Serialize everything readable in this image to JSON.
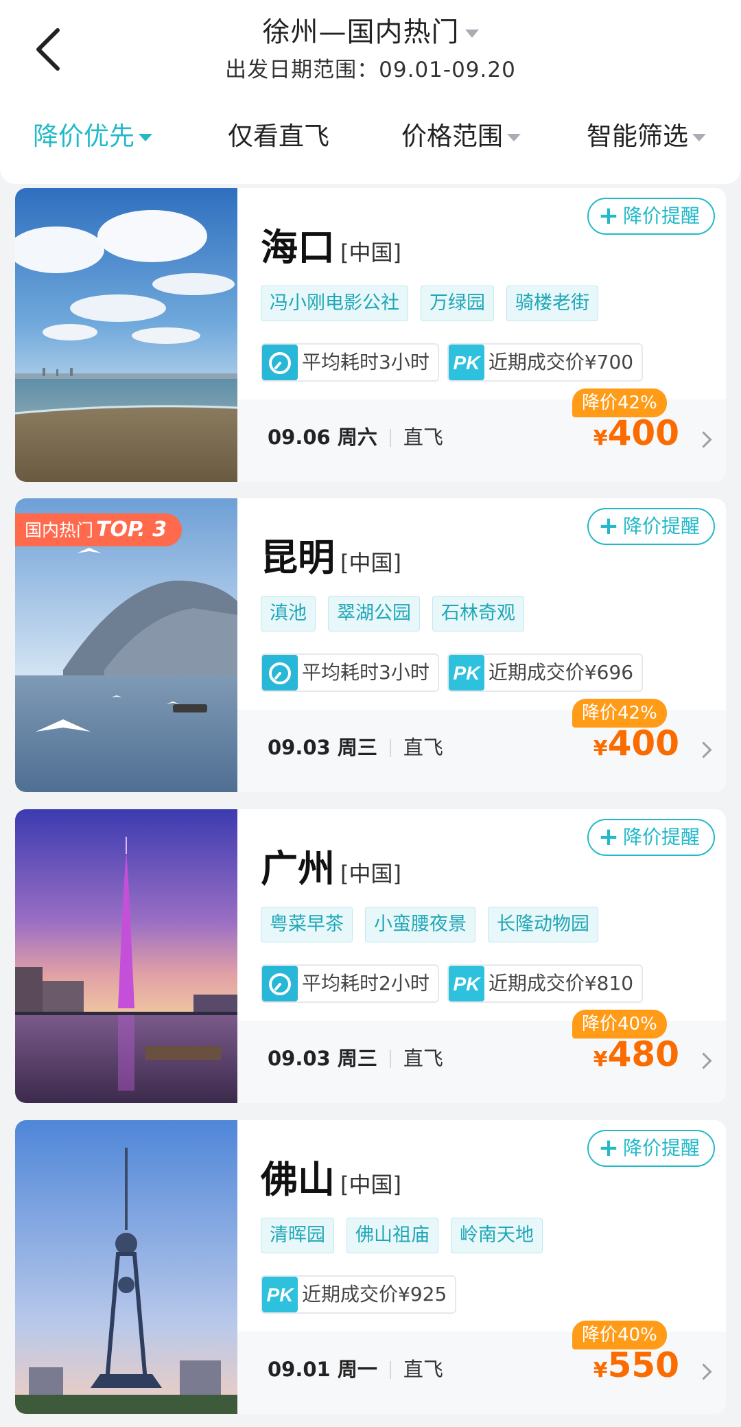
{
  "header": {
    "title": "徐州—国内热门",
    "subtitle": "出发日期范围：09.01-09.20"
  },
  "filters": [
    {
      "label": "降价优先",
      "active": true
    },
    {
      "label": "仅看直飞",
      "active": false
    },
    {
      "label": "价格范围",
      "active": false
    },
    {
      "label": "智能筛选",
      "active": false
    }
  ],
  "alert_label": "降价提醒",
  "cards": [
    {
      "city": "海口",
      "country": "[中国]",
      "tags": [
        "冯小刚电影公社",
        "万绿园",
        "骑楼老街"
      ],
      "duration": "平均耗时3小时",
      "recent_price": "近期成交价¥700",
      "date": "09.06 周六",
      "flight": "直飞",
      "discount": "降价42%",
      "currency": "¥",
      "price": "400"
    },
    {
      "city": "昆明",
      "country": "[中国]",
      "rank_label": "国内热门",
      "rank_top": "TOP. 3",
      "tags": [
        "滇池",
        "翠湖公园",
        "石林奇观"
      ],
      "duration": "平均耗时3小时",
      "recent_price": "近期成交价¥696",
      "date": "09.03 周三",
      "flight": "直飞",
      "discount": "降价42%",
      "currency": "¥",
      "price": "400"
    },
    {
      "city": "广州",
      "country": "[中国]",
      "tags": [
        "粤菜早茶",
        "小蛮腰夜景",
        "长隆动物园"
      ],
      "duration": "平均耗时2小时",
      "recent_price": "近期成交价¥810",
      "date": "09.03 周三",
      "flight": "直飞",
      "discount": "降价40%",
      "currency": "¥",
      "price": "480"
    },
    {
      "city": "佛山",
      "country": "[中国]",
      "tags": [
        "清晖园",
        "佛山祖庙",
        "岭南天地"
      ],
      "recent_price": "近期成交价¥925",
      "date": "09.01 周一",
      "flight": "直飞",
      "discount": "降价40%",
      "currency": "¥",
      "price": "550"
    }
  ],
  "icons": {
    "back": "chevron-left-icon",
    "clock": "clock-icon",
    "pk": "pk-icon",
    "plus": "plus-icon"
  },
  "colors": {
    "accent": "#23b9c9",
    "price": "#fa6c00",
    "discount_badge": "#ff9b17",
    "rank_badge": "#ff6a4d"
  }
}
